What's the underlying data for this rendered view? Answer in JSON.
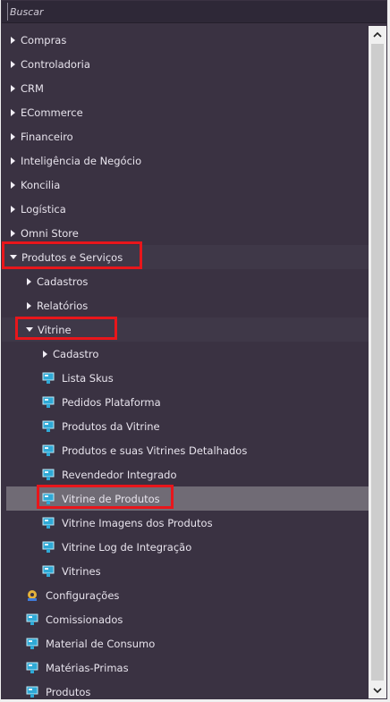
{
  "search": {
    "placeholder": "Buscar"
  },
  "tree": {
    "compras": "Compras",
    "controladoria": "Controladoria",
    "crm": "CRM",
    "ecommerce": "ECommerce",
    "financeiro": "Financeiro",
    "inteligencia": "Inteligência de Negócio",
    "koncilia": "Koncilia",
    "logistica": "Logística",
    "omni": "Omni Store",
    "produtos_servicos": "Produtos e Serviços",
    "cadastros": "Cadastros",
    "relatorios": "Relatórios",
    "vitrine": "Vitrine",
    "cadastro": "Cadastro",
    "lista_skus": "Lista Skus",
    "pedidos_plataforma": "Pedidos Plataforma",
    "produtos_vitrine": "Produtos da Vitrine",
    "produtos_suas_vitrines": "Produtos e suas Vitrines Detalhados",
    "revendedor": "Revendedor Integrado",
    "vitrine_produtos": "Vitrine de Produtos",
    "vitrine_imagens": "Vitrine Imagens dos Produtos",
    "vitrine_log": "Vitrine Log de Integração",
    "vitrines": "Vitrines",
    "configuracoes": "Configurações",
    "comissionados": "Comissionados",
    "material_consumo": "Material de Consumo",
    "materias_primas": "Matérias-Primas",
    "produtos": "Produtos"
  },
  "icons": {
    "report": "report-icon",
    "config": "config-icon",
    "expand": "triangle-right-icon",
    "collapse": "triangle-down-icon"
  },
  "colors": {
    "background": "#3a3242",
    "selected": "#706b75",
    "highlight_box": "#e8161b"
  }
}
